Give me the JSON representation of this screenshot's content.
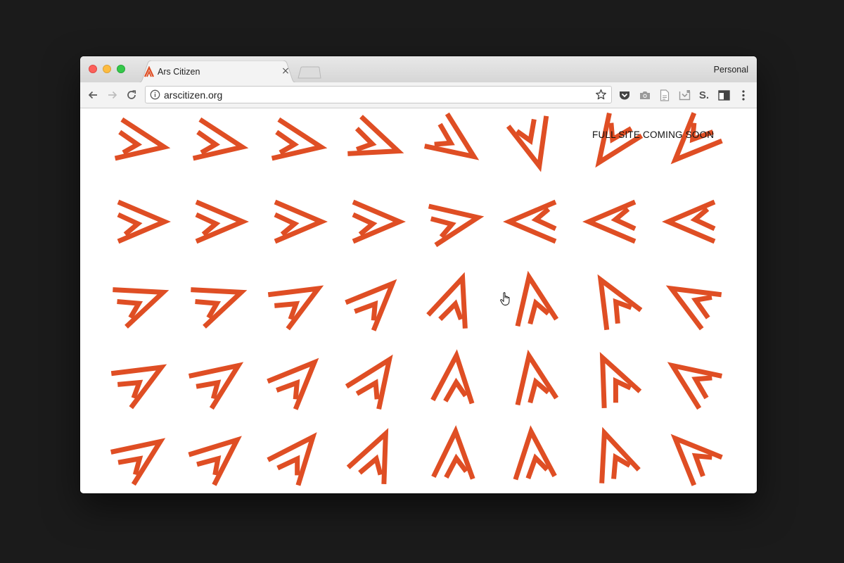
{
  "window": {
    "tab_title": "Ars Citizen",
    "tab_close_symbol": "×",
    "profile_label": "Personal",
    "favicon_icon": "ars-citizen-logo-icon"
  },
  "toolbar": {
    "back_icon": "arrow-left-icon",
    "forward_icon": "arrow-right-icon",
    "reload_icon": "reload-icon",
    "info_icon": "info-icon",
    "url": "arscitizen.org",
    "bookmark_icon": "star-icon",
    "extensions": [
      "pocket-icon",
      "camera-icon",
      "document-icon",
      "inbox-icon",
      "s-logo-icon",
      "sidebar-panel-icon",
      "kebab-menu-icon"
    ],
    "s_extension_label": "S."
  },
  "page": {
    "headline": "FULL SITE COMING SOON",
    "brand_color": "#df4e24",
    "mark_icon": "ars-citizen-a-logo-icon"
  }
}
